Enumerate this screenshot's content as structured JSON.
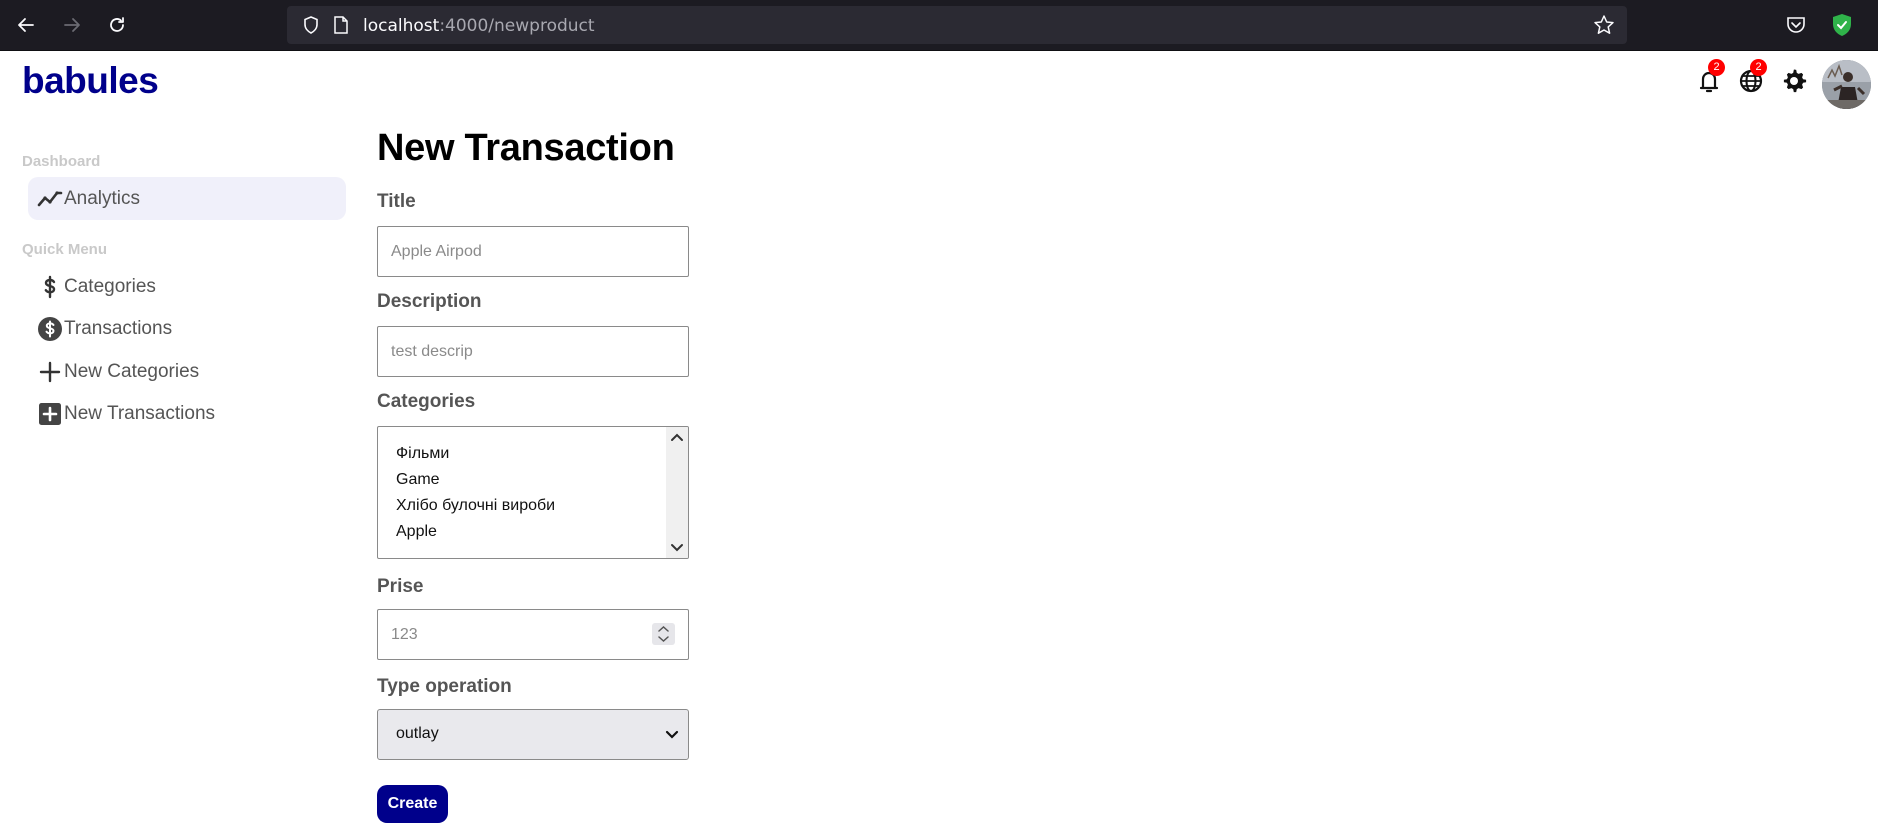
{
  "browser": {
    "url_host": "localhost",
    "url_path": ":4000/newproduct"
  },
  "app": {
    "logo": "babules",
    "notifications_badge": "2",
    "language_badge": "2"
  },
  "sidebar": {
    "dashboard_title": "Dashboard",
    "quick_menu_title": "Quick Menu",
    "items": [
      {
        "label": "Analytics",
        "icon": "chart-line-icon"
      },
      {
        "label": "Categories",
        "icon": "dollar-icon"
      },
      {
        "label": "Transactions",
        "icon": "dollar-circle-icon"
      },
      {
        "label": "New Categories",
        "icon": "plus-icon"
      },
      {
        "label": "New Transactions",
        "icon": "plus-square-icon"
      }
    ]
  },
  "form": {
    "title": "New Transaction",
    "title_label": "Title",
    "title_placeholder": "Apple Airpod",
    "description_label": "Description",
    "description_placeholder": "test descrip",
    "categories_label": "Categories",
    "categories_options": [
      "Фільми",
      "Game",
      "Хлібо булочні вироби",
      "Apple"
    ],
    "price_label": "Prise",
    "price_placeholder": "123",
    "type_label": "Type operation",
    "type_value": "outlay",
    "submit_label": "Create"
  },
  "colors": {
    "brand": "#00008b",
    "badge": "#ff0000",
    "active_item_bg": "#f0f0fa"
  }
}
